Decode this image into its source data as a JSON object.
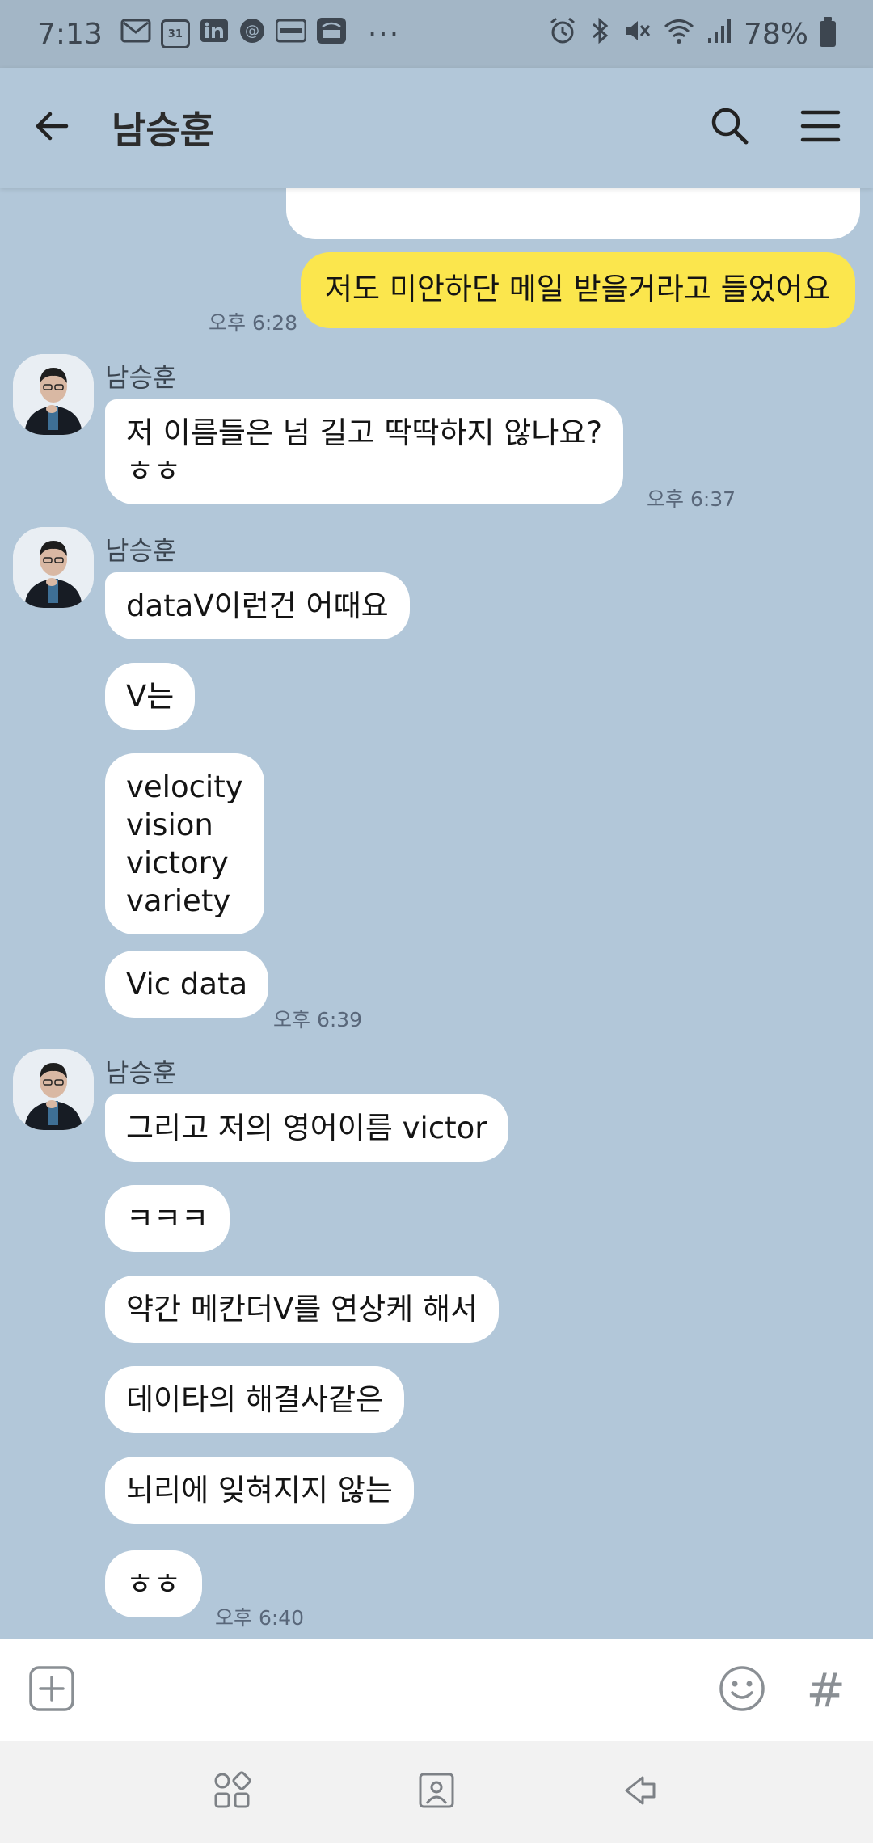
{
  "status": {
    "time": "7:13",
    "notif_icons": [
      "gmail-icon",
      "calendar-icon",
      "linkedin-icon",
      "messenger-icon",
      "payco-icon",
      "citi-icon"
    ],
    "calendar_day": "31",
    "more": "···",
    "battery": "78%"
  },
  "header": {
    "title": "남승훈"
  },
  "messages": {
    "out1": {
      "text": "저도 미안하단 메일 받을거라고 들었어요",
      "time": "오후 6:28"
    },
    "group1": {
      "sender": "남승훈",
      "m1": "저 이름들은 넘 길고 딱딱하지 않나요?\nㅎㅎ",
      "time": "오후 6:37"
    },
    "group2": {
      "sender": "남승훈",
      "m1": "dataV이런건 어때요",
      "m2": "V는",
      "m3": "velocity\nvision\nvictory\nvariety",
      "m4": "Vic data",
      "time": "오후 6:39"
    },
    "group3": {
      "sender": "남승훈",
      "m1": "그리고 저의 영어이름 victor",
      "m2": "ㅋㅋㅋ",
      "m3": "약간 메칸더V를 연상케 해서",
      "m4": "데이타의 해결사같은",
      "m5": "뇌리에 잊혀지지 않는",
      "m6": "ㅎㅎ",
      "time": "오후 6:40"
    }
  },
  "colors": {
    "chat_bg": "#b2c7d9",
    "outgoing_bubble": "#fbe64d",
    "incoming_bubble": "#ffffff"
  }
}
